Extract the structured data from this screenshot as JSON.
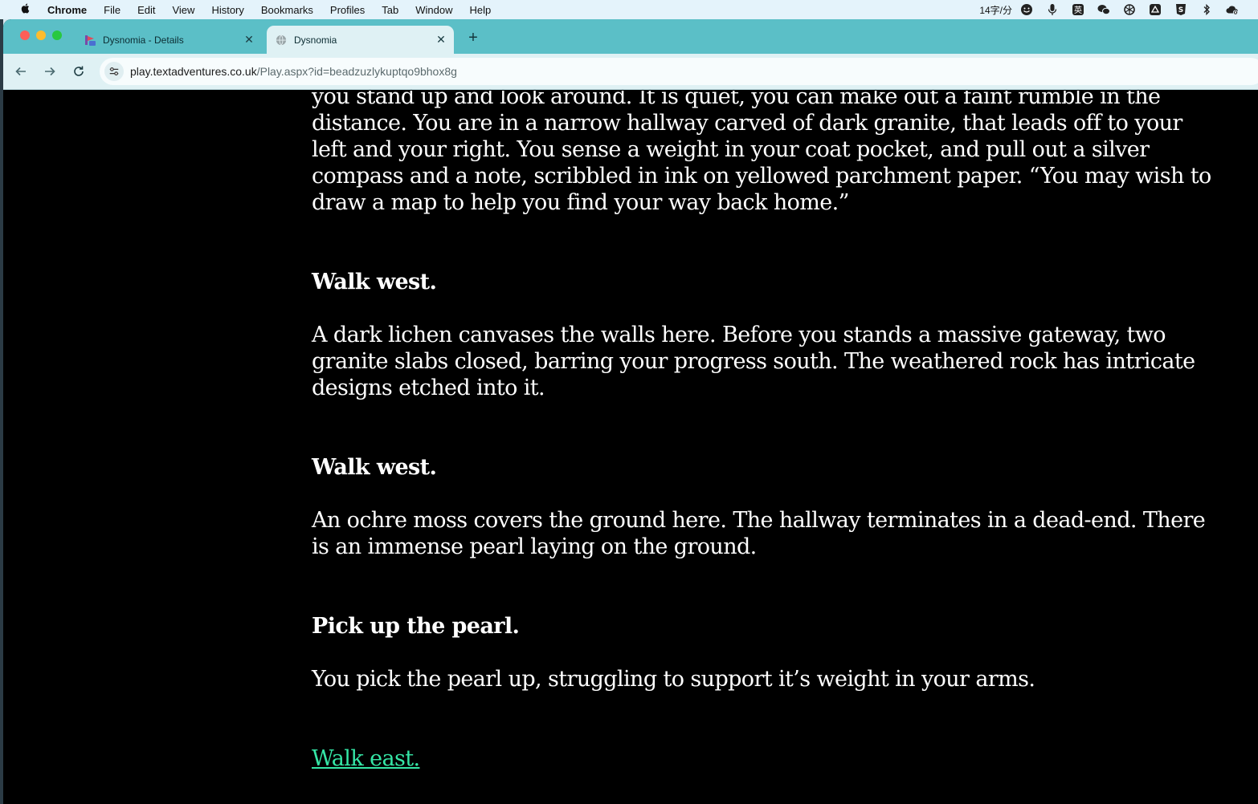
{
  "menubar": {
    "app": "Chrome",
    "items": [
      "File",
      "Edit",
      "View",
      "History",
      "Bookmarks",
      "Profiles",
      "Tab",
      "Window",
      "Help"
    ],
    "status_text": "14字/分",
    "status_icons": [
      "emoji-icon",
      "microphone-icon",
      "input-method-icon",
      "wechat-icon",
      "openai-icon",
      "drive-icon",
      "s-app-icon",
      "bluetooth-icon",
      "cloud-icon"
    ]
  },
  "tabs": [
    {
      "title": "Dysnomia - Details",
      "active": false,
      "favicon": "textadventures-icon"
    },
    {
      "title": "Dysnomia",
      "active": true,
      "favicon": "globe-icon"
    }
  ],
  "address": {
    "host": "play.textadventures.co.uk",
    "path": "/Play.aspx?id=beadzuzlykuptqo9bhox8g"
  },
  "story": {
    "intro": "you stand up and look around. It is quiet, you can make out a faint rumble in the distance. You are in a narrow hallway carved of dark granite, that leads off to your left and your right. You sense a weight in your coat pocket, and pull out a silver compass and a note, scribbled in ink on yellowed parchment paper. “You may wish to draw a map to help you find your way back home.”",
    "cmd1": "Walk west.",
    "resp1": "A dark lichen canvases the walls here. Before you stands a massive gateway, two granite slabs closed, barring your progress south. The weathered rock has intricate designs etched into it.",
    "cmd2": "Walk west.",
    "resp2": "An ochre moss covers the ground here. The hallway terminates in a dead-end. There is an immense pearl laying on the ground.",
    "cmd3": "Pick up the pearl.",
    "resp3": "You pick the pearl up, struggling to support it’s weight in your arms.",
    "link": "Walk east.",
    "link_color": "#35e6a6"
  }
}
